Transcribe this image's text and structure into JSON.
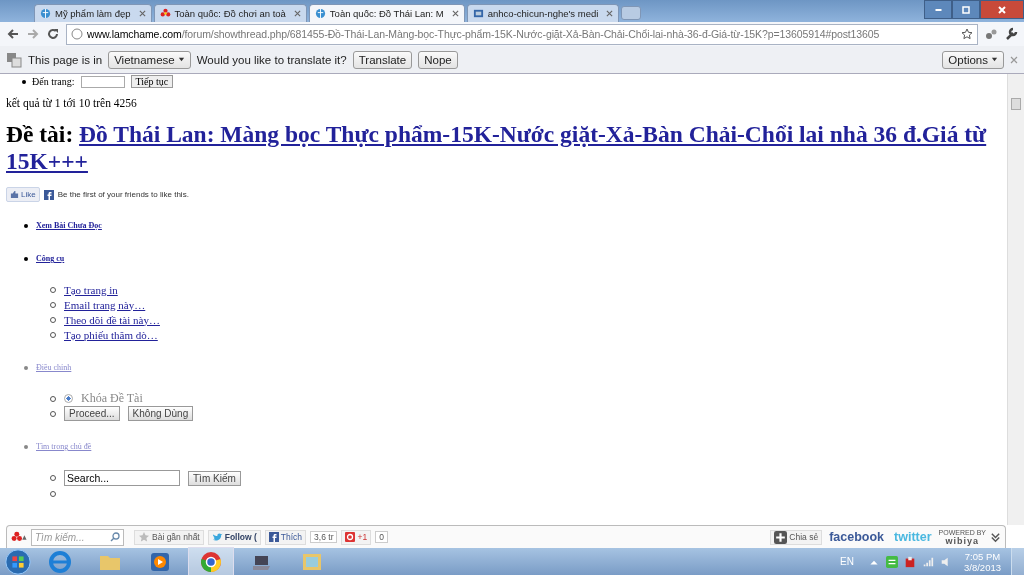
{
  "tabs": [
    {
      "title": "Mỹ phẩm làm đẹp",
      "selected": false
    },
    {
      "title": "Toàn quốc: Đồ chơi an toà",
      "selected": false
    },
    {
      "title": "Toàn quốc: Đồ Thái Lan: M",
      "selected": true
    },
    {
      "title": "anhco-chicun-nghe's medi",
      "selected": false
    }
  ],
  "address": {
    "domain": "www.lamchame.com",
    "path": "/forum/showthread.php/681455-Đồ-Thái-Lan-Màng-bọc-Thực-phẩm-15K-Nước-giặt-Xả-Bàn-Chải-Chổi-lai-nhà-36-đ-Giá-từ-15K?p=13605914#post13605"
  },
  "translate_bar": {
    "prefix": "This page is in",
    "language": "Vietnamese",
    "question": "Would you like to translate it?",
    "buttons": [
      "Translate",
      "Nope"
    ],
    "options": "Options"
  },
  "page": {
    "goto_label": "Đến trang:",
    "goto_button": "Tiếp tục",
    "results": "kết quả từ 1 tới 10 trên 4256",
    "heading_prefix": "Đề tài:",
    "heading_link": "Đồ Thái Lan: Màng bọc Thực phẩm-15K-Nước giặt-Xả-Bàn Chải-Chổi lai nhà 36 đ.Giá từ 15K+++",
    "like_button": "Like",
    "like_text": "Be the first of your friends to like this.",
    "sections": [
      {
        "title": "Xem Bài Chưa Đọc",
        "kind": "link",
        "dimmed": false
      },
      {
        "title": "Công cụ",
        "kind": "links",
        "dimmed": false,
        "links": [
          "Tạo trang in",
          "Email trang này…",
          "Theo dõi đề tài này…",
          "Tạo phiếu thăm dò…"
        ]
      },
      {
        "title": "Điều chỉnh",
        "kind": "moderation",
        "dimmed": true,
        "radio": {
          "label": "Khóa Đề Tài",
          "checked": true
        },
        "buttons": [
          "Proceed...",
          "Không Dùng"
        ]
      },
      {
        "title": "Tìm trong chủ đề",
        "kind": "search",
        "dimmed": true,
        "value": "Search...",
        "button": "Tìm Kiếm"
      }
    ]
  },
  "toolbar": {
    "search_placeholder": "Tìm kiếm...",
    "recent": "Bài gần nhất",
    "follow": "Follow (",
    "like": "Thích",
    "like_count": "3,6 tr",
    "plus": "+1",
    "plus_count": "0",
    "share": "Chia sẻ",
    "facebook": "facebook",
    "twitter": "twitter",
    "powered_by": "POWERED BY",
    "wibiya": "wibiya"
  },
  "taskbar": {
    "language": "EN",
    "time": "7:05 PM",
    "date": "3/8/2013"
  }
}
